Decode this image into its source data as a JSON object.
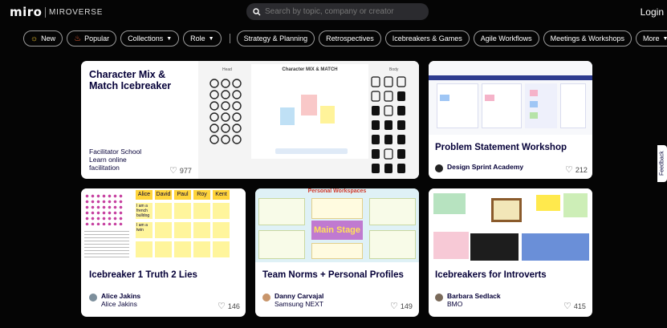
{
  "header": {
    "logo": "miro",
    "brand_sub": "MIROVERSE",
    "search_placeholder": "Search by topic, company or creator",
    "login": "Login"
  },
  "filters": [
    {
      "label": "New",
      "icon": "sun-icon"
    },
    {
      "label": "Popular",
      "icon": "fire-icon"
    },
    {
      "label": "Collections",
      "dropdown": true
    },
    {
      "label": "Role",
      "dropdown": true
    },
    {
      "label": "Strategy & Planning"
    },
    {
      "label": "Retrospectives"
    },
    {
      "label": "Icebreakers & Games"
    },
    {
      "label": "Agile Workflows"
    },
    {
      "label": "Meetings & Workshops"
    },
    {
      "label": "More",
      "dropdown": true
    }
  ],
  "cards": [
    {
      "title": "Character Mix & Match Icebreaker",
      "author": "Facilitator School",
      "org": "Learn online facilitation",
      "likes": "977",
      "thumb_title": "Character MIX & MATCH",
      "thumb_head": "Head",
      "thumb_body": "Body"
    },
    {
      "title": "Problem Statement Workshop",
      "author": "Design Sprint Academy",
      "org": "",
      "likes": "212"
    },
    {
      "title": "Icebreaker 1 Truth 2 Lies",
      "author": "Alice Jakins",
      "org": "Alice Jakins",
      "likes": "146",
      "names": [
        "Alice",
        "David",
        "Paul",
        "Roy",
        "Kent"
      ],
      "note_texts": [
        "I am a french bulldog",
        "I am a twin"
      ]
    },
    {
      "title": "Team Norms + Personal Profiles",
      "author": "Danny Carvajal",
      "org": "Samsung NEXT",
      "likes": "149",
      "thumb_title": "Personal Workspaces",
      "thumb_stage": "Main Stage"
    },
    {
      "title": "Icebreakers for Introverts",
      "author": "Barbara Sedlack",
      "org": "BMO",
      "likes": "415"
    }
  ],
  "feedback": "Feedback",
  "colors": {
    "background": "#050505",
    "card_text": "#050038",
    "sticky_yellow": "#fff59c",
    "stage_purple": "#c07ad0"
  }
}
